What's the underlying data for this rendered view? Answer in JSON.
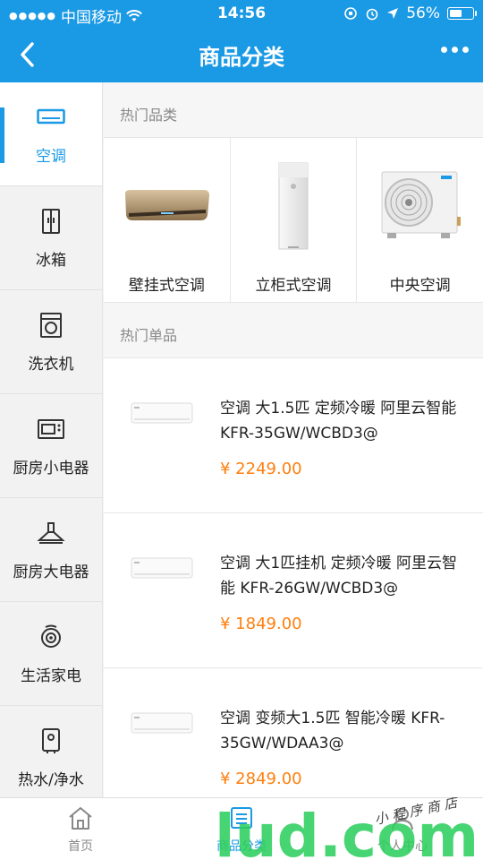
{
  "status_bar": {
    "carrier": "中国移动",
    "time": "14:56",
    "battery": "56%",
    "battery_level": 0.56
  },
  "nav": {
    "title": "商品分类",
    "back_icon": "chevron-left-icon",
    "more_icon": "more-dots-icon"
  },
  "sidebar": {
    "items": [
      {
        "label": "空调",
        "icon": "air-conditioner-icon",
        "active": true
      },
      {
        "label": "冰箱",
        "icon": "fridge-icon",
        "active": false
      },
      {
        "label": "洗衣机",
        "icon": "washing-machine-icon",
        "active": false
      },
      {
        "label": "厨房小电器",
        "icon": "microwave-icon",
        "active": false
      },
      {
        "label": "厨房大电器",
        "icon": "range-hood-icon",
        "active": false
      },
      {
        "label": "生活家电",
        "icon": "fan-icon",
        "active": false
      },
      {
        "label": "热水/净水",
        "icon": "water-heater-icon",
        "active": false
      }
    ]
  },
  "main": {
    "hot_categories_title": "热门品类",
    "hot_categories": [
      {
        "label": "壁挂式空调"
      },
      {
        "label": "立柜式空调"
      },
      {
        "label": "中央空调"
      }
    ],
    "hot_products_title": "热门单品",
    "products": [
      {
        "name": "空调 大1.5匹 定频冷暖 阿里云智能 KFR-35GW/WCBD3@",
        "price": "¥ 2249.00"
      },
      {
        "name": "空调 大1匹挂机 定频冷暖 阿里云智能 KFR-26GW/WCBD3@",
        "price": "¥ 1849.00"
      },
      {
        "name": "空调 变频大1.5匹 智能冷暖 KFR-35GW/WDAA3@",
        "price": "¥ 2849.00"
      }
    ]
  },
  "tabbar": {
    "tabs": [
      {
        "label": "首页",
        "icon": "home-icon",
        "active": false
      },
      {
        "label": "商品分类",
        "icon": "category-icon",
        "active": true
      },
      {
        "label": "个人中心",
        "icon": "user-icon",
        "active": false
      }
    ]
  },
  "watermark": {
    "brand": "lud.com",
    "tagline": "小 程 序 商 店"
  },
  "colors": {
    "primary": "#1a99e5",
    "price": "#ff7f0e",
    "watermark_green": "#2ecf5f"
  }
}
